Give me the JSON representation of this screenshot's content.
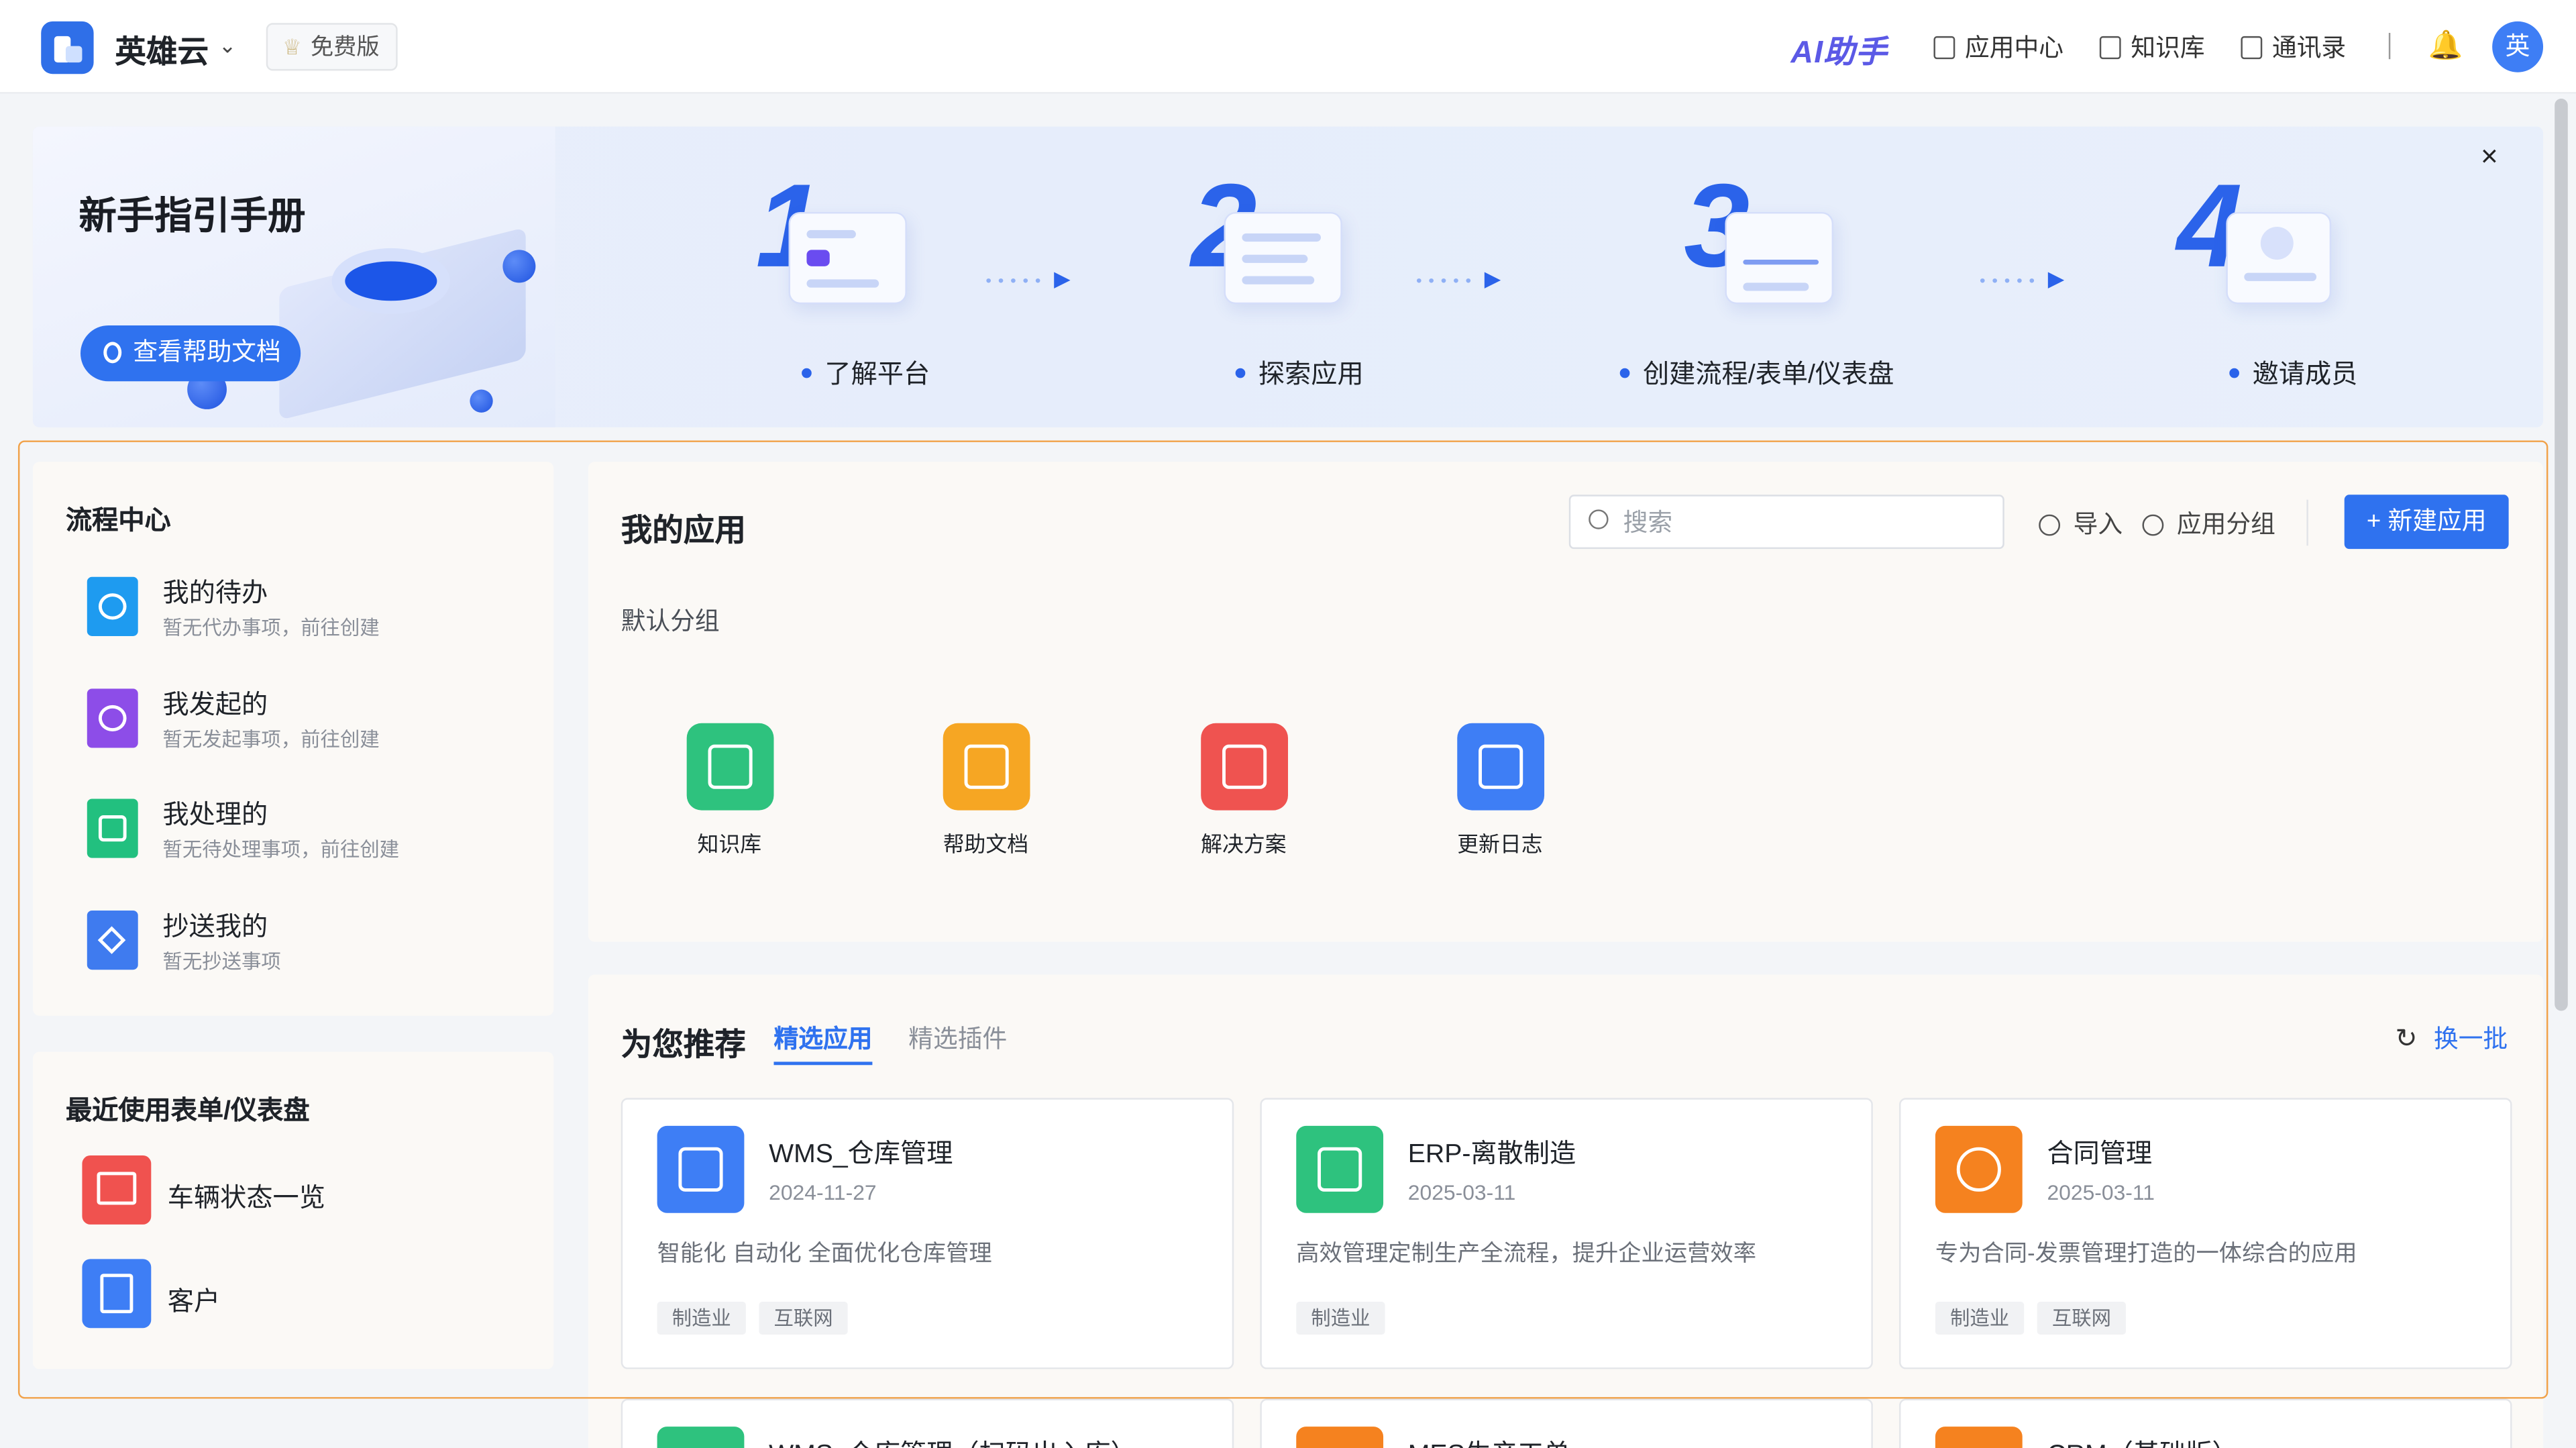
{
  "topbar": {
    "brand": "英雄云",
    "edition": "免费版",
    "ai_label": "AI助手",
    "nav": [
      "应用中心",
      "知识库",
      "通讯录"
    ],
    "avatar": "英"
  },
  "banner": {
    "title": "新手指引手册",
    "help_button": "查看帮助文档",
    "steps": [
      {
        "num": "1",
        "label": "了解平台"
      },
      {
        "num": "2",
        "label": "探索应用"
      },
      {
        "num": "3",
        "label": "创建流程/表单/仪表盘"
      },
      {
        "num": "4",
        "label": "邀请成员"
      }
    ],
    "close": "×"
  },
  "flow_center": {
    "title": "流程中心",
    "items": [
      {
        "name": "我的待办",
        "desc": "暂无代办事项，前往创建",
        "color": "#1e9bf0"
      },
      {
        "name": "我发起的",
        "desc": "暂无发起事项，前往创建",
        "color": "#8d4de8"
      },
      {
        "name": "我处理的",
        "desc": "暂无待处理事项，前往创建",
        "color": "#22c07f"
      },
      {
        "name": "抄送我的",
        "desc": "暂无抄送事项",
        "color": "#3f7bef"
      }
    ]
  },
  "recent": {
    "title": "最近使用表单/仪表盘",
    "items": [
      {
        "name": "车辆状态一览",
        "color": "#f0524f"
      },
      {
        "name": "客户",
        "color": "#3e7ef5"
      }
    ]
  },
  "my_apps": {
    "title": "我的应用",
    "search_placeholder": "搜索",
    "import": "导入",
    "grouping": "应用分组",
    "new_app": "+ 新建应用",
    "group": "默认分组",
    "apps": [
      {
        "name": "知识库",
        "color": "#2ec27e"
      },
      {
        "name": "帮助文档",
        "color": "#f6a623"
      },
      {
        "name": "解决方案",
        "color": "#ef5350"
      },
      {
        "name": "更新日志",
        "color": "#3e7ef5"
      }
    ]
  },
  "recommend": {
    "title": "为您推荐",
    "tabs": [
      "精选应用",
      "精选插件"
    ],
    "refresh": "换一批",
    "cards": [
      {
        "name": "WMS_仓库管理",
        "date": "2024-11-27",
        "desc": "智能化 自动化 全面优化仓库管理",
        "tags": [
          "制造业",
          "互联网"
        ],
        "color": "#3e7ef5"
      },
      {
        "name": "ERP-离散制造",
        "date": "2025-03-11",
        "desc": "高效管理定制生产全流程，提升企业运营效率",
        "tags": [
          "制造业"
        ],
        "color": "#2ec27e"
      },
      {
        "name": "合同管理",
        "date": "2025-03-11",
        "desc": "专为合同-发票管理打造的一体综合的应用",
        "tags": [
          "制造业",
          "互联网"
        ],
        "color": "#f5821f"
      }
    ],
    "partial_cards": [
      {
        "name": "WMS_仓库管理（扫码出入库）",
        "color": "#2ec27e"
      },
      {
        "name": "MES生产工单",
        "color": "#f5821f"
      },
      {
        "name": "CRM（基础版）",
        "color": "#f5821f"
      }
    ]
  }
}
